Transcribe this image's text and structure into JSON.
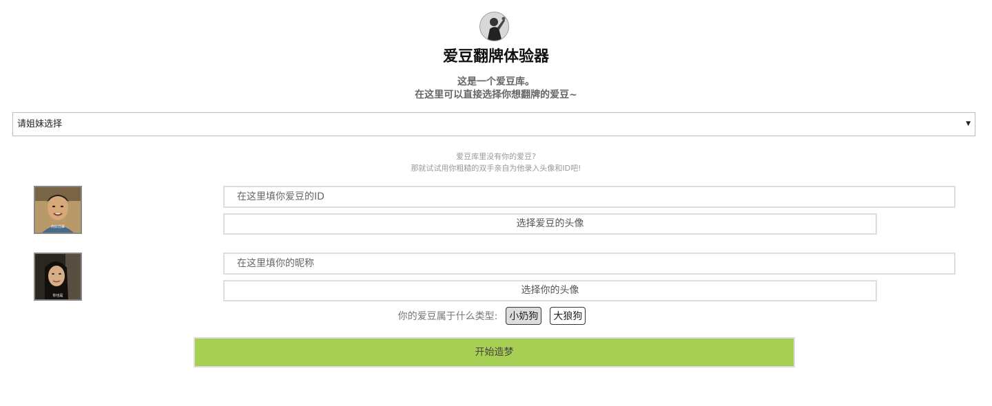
{
  "header": {
    "logo_icon": "user-photo-icon",
    "title": "爱豆翻牌体验器",
    "subtitle_line1": "这是一个爱豆库。",
    "subtitle_line2": "在这里可以直接选择你想翻牌的爱豆~"
  },
  "idol_select": {
    "selected": "请姐妹选择",
    "arrow": "▼"
  },
  "hint": {
    "line1": "爱豆库里没有你的爱豆?",
    "line2": "那就试试用你粗糙的双手亲自为他录入头像和ID吧!"
  },
  "idol": {
    "id_placeholder": "在这里填你爱豆的ID",
    "avatar_button": "选择爱豆的头像",
    "avatar_caption": "你好前辈"
  },
  "me": {
    "nickname_placeholder": "在这里填你的昵称",
    "avatar_button": "选择你的头像",
    "avatar_caption": "你也是"
  },
  "type": {
    "label": "你的爱豆属于什么类型:",
    "options": [
      "小奶狗",
      "大狼狗"
    ],
    "selected_index": 0
  },
  "start_button": "开始造梦",
  "colors": {
    "accent": "#a6cf53",
    "title": "#111111",
    "muted": "#999999"
  }
}
